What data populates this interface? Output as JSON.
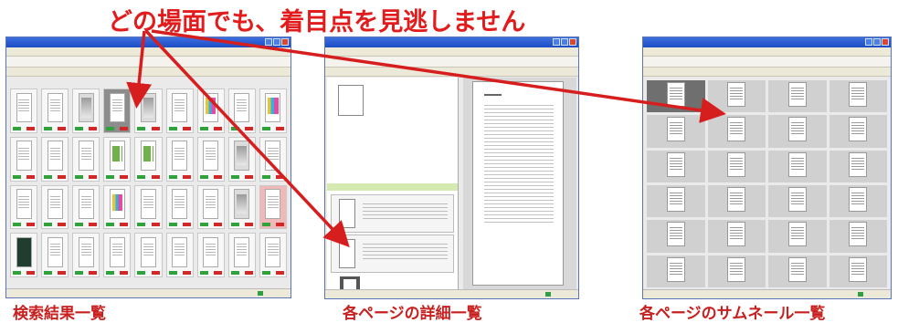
{
  "headline": "どの場面でも、着目点を見逃しません",
  "captions": {
    "search": "検索結果一覧",
    "detail": "各ページの詳細一覧",
    "thumbnail": "各ページのサムネール一覧"
  },
  "colors": {
    "headline": "#e21c1c",
    "caption": "#c8201f",
    "arrow": "#d71e1e",
    "titlebar": "#1c4cc4"
  },
  "icons": {
    "window_controls": [
      "minimize-icon",
      "maximize-icon",
      "close-icon"
    ]
  }
}
